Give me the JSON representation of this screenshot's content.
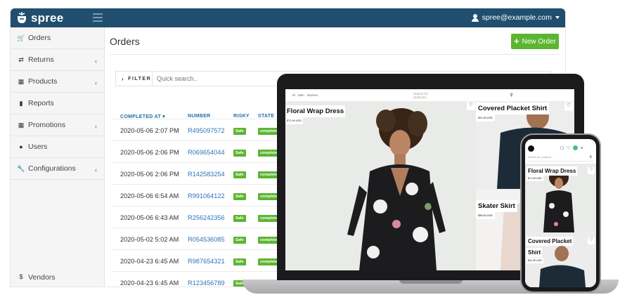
{
  "app": {
    "logo_text": "spree",
    "user_email": "spree@example.com"
  },
  "sidebar": {
    "items": [
      {
        "label": "Orders",
        "icon": "cart-icon",
        "has_chevron": false
      },
      {
        "label": "Returns",
        "icon": "exchange-icon",
        "has_chevron": true
      },
      {
        "label": "Products",
        "icon": "grid-icon",
        "has_chevron": true
      },
      {
        "label": "Reports",
        "icon": "file-icon",
        "has_chevron": false
      },
      {
        "label": "Promotions",
        "icon": "gift-icon",
        "has_chevron": true
      },
      {
        "label": "Users",
        "icon": "user-icon",
        "has_chevron": false
      },
      {
        "label": "Configurations",
        "icon": "wrench-icon",
        "has_chevron": true
      }
    ],
    "vendors": {
      "label": "Vendors",
      "icon": "dollar-icon"
    }
  },
  "main": {
    "title": "Orders",
    "new_order_label": "New Order",
    "filter_label": "FILTER",
    "search_placeholder": "Quick search..",
    "columns": [
      "COMPLETED AT",
      "NUMBER",
      "RISKY",
      "STATE"
    ],
    "rows": [
      {
        "completed_at": "2020-05-06 2:07 PM",
        "number": "R495097572",
        "risky": "Safe",
        "state": "complete"
      },
      {
        "completed_at": "2020-05-06 2:06 PM",
        "number": "R069654044",
        "risky": "Safe",
        "state": "complete"
      },
      {
        "completed_at": "2020-05-06 2:06 PM",
        "number": "R142583254",
        "risky": "Safe",
        "state": "complete"
      },
      {
        "completed_at": "2020-05-06 6:54 AM",
        "number": "R991064122",
        "risky": "Safe",
        "state": "complete"
      },
      {
        "completed_at": "2020-05-06 6:43 AM",
        "number": "R256242356",
        "risky": "Safe",
        "state": "complete"
      },
      {
        "completed_at": "2020-05-02 5:02 AM",
        "number": "R054536085",
        "risky": "Safe",
        "state": "complete"
      },
      {
        "completed_at": "2020-04-23 6:45 AM",
        "number": "R987654321",
        "risky": "Safe",
        "state": "complete"
      },
      {
        "completed_at": "2020-04-23 6:45 AM",
        "number": "R123456789",
        "risky": "Safe",
        "state": "complete"
      }
    ]
  },
  "storefront_laptop": {
    "nav_links": [
      "All",
      "Men",
      "Women"
    ],
    "search_placeholder": "Search for products...",
    "hero": {
      "title": "Floral Wrap Dress",
      "price": "$71.99 USD"
    },
    "side_top": {
      "title": "Covered Placket Shirt",
      "price": "$31.99 USD"
    },
    "side_bottom": {
      "title": "Skater Skirt",
      "price": "$58.59 USD"
    }
  },
  "storefront_phone": {
    "search_placeholder": "Search for products...",
    "card1": {
      "title": "Floral Wrap Dress",
      "price": "$71.99 USD"
    },
    "card2": {
      "title_line1": "Covered Placket",
      "title_line2": "Shirt",
      "price": "$41.99 USD"
    }
  },
  "colors": {
    "topbar": "#1f4e6f",
    "accent_green": "#5cb531",
    "link_blue": "#2d73b4"
  }
}
